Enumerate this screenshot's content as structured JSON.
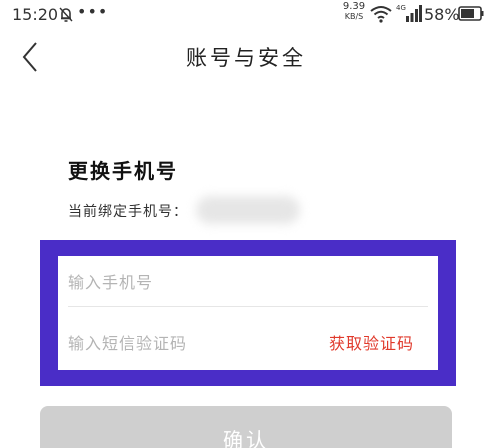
{
  "status_bar": {
    "time": "15:20",
    "dots": "•••",
    "speed_value": "9.39",
    "speed_unit": "KB/S",
    "network": "4G",
    "battery": "58%",
    "icons": [
      "alarm-off-icon",
      "wifi-icon",
      "signal-icon",
      "battery-icon"
    ]
  },
  "nav": {
    "title": "账号与安全",
    "back_icon": "chevron-left-icon"
  },
  "section": {
    "title": "更换手机号",
    "current_label": "当前绑定手机号："
  },
  "form": {
    "phone_placeholder": "输入手机号",
    "code_placeholder": "输入短信验证码",
    "get_code_label": "获取验证码"
  },
  "confirm_label": "确认",
  "colors": {
    "highlight": "#4a2dc7",
    "accent_red": "#e03a2c",
    "button_disabled": "#cfcfcf"
  }
}
